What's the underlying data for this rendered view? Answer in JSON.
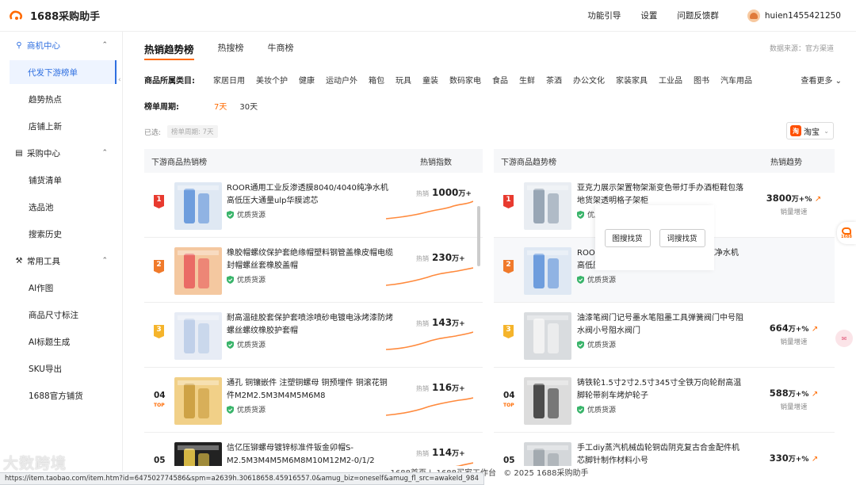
{
  "header": {
    "app_title": "1688采购助手",
    "nav": [
      "功能引导",
      "设置",
      "问题反馈群"
    ],
    "username": "huien1455421250"
  },
  "sidebar": {
    "groups": [
      {
        "label": "商机中心",
        "icon": "bulb-icon",
        "items": [
          "代发下游榜单",
          "趋势热点",
          "店铺上新"
        ]
      },
      {
        "label": "采购中心",
        "icon": "document-icon",
        "items": [
          "铺货清单",
          "选品池",
          "搜索历史"
        ]
      },
      {
        "label": "常用工具",
        "icon": "wrench-icon",
        "items": [
          "AI作图",
          "商品尺寸标注",
          "AI标题生成",
          "SKU导出",
          "1688官方铺货"
        ]
      }
    ],
    "active_item": "代发下游榜单"
  },
  "main": {
    "tabs": [
      "热销趋势榜",
      "热搜榜",
      "牛商榜"
    ],
    "active_tab": "热销趋势榜",
    "source_text": "数据来源：官方渠道",
    "category_label": "商品所属类目:",
    "categories": [
      "家居日用",
      "美妆个护",
      "健康",
      "运动户外",
      "箱包",
      "玩具",
      "童装",
      "数码家电",
      "食品",
      "生鲜",
      "茶酒",
      "办公文化",
      "家装家具",
      "工业品",
      "图书",
      "汽车用品"
    ],
    "category_more": "查看更多",
    "period_label": "榜单周期:",
    "periods": [
      "7天",
      "30天"
    ],
    "active_period": "7天",
    "selected_label": "已选:",
    "selected_chip": "榜单周期: 7天",
    "platform": "淘宝"
  },
  "left_panel": {
    "header": "下游商品热销榜",
    "col2": "热销指数",
    "metric_label": "热销",
    "rows": [
      {
        "rank": "1",
        "title": "ROOR通用工业反渗透膜8040/4040纯净水机高低压大通量ulp华膜滤芯",
        "badge": "优质货源",
        "value": "1000",
        "unit": "万+"
      },
      {
        "rank": "2",
        "title": "橡胶帽螺纹保护套绝缘帽塑料钢管盖橡皮帽电缆封帽螺丝套橡胶盖帽",
        "badge": "优质货源",
        "value": "230",
        "unit": "万+"
      },
      {
        "rank": "3",
        "title": "耐高温硅胶套保护套喷涂喷砂电镀电泳烤漆防烤螺丝螺纹橡胶护套帽",
        "badge": "优质货源",
        "value": "143",
        "unit": "万+"
      },
      {
        "rank": "04",
        "top": "TOP",
        "title": "通孔 铜镶嵌件 注塑铜螺母 铜预埋件 铜滚花铜件M2M2.5M3M4M5M6M8",
        "badge": "优质货源",
        "value": "116",
        "unit": "万+"
      },
      {
        "rank": "05",
        "top": "TOP",
        "title": "信亿压铆螺母镀锌标准件钣金卯帽S-M2.5M3M4M5M6M8M10M12M2-0/1/2",
        "badge": "优质货源",
        "value": "114",
        "unit": "万+"
      }
    ]
  },
  "right_panel": {
    "header": "下游商品趋势榜",
    "col2": "热销趋势",
    "sub_label": "销量增速",
    "rows": [
      {
        "rank": "1",
        "title": "亚克力展示架置物架渐变色带灯手办酒柜鞋包落地货架透明格子架柜",
        "badge": "优质货源",
        "value": "3800",
        "unit": "万+%"
      },
      {
        "rank": "2",
        "title": "ROOR通用工业反渗透膜8040/4040纯净水机高低压大通量ulp华膜滤芯",
        "badge": "优质货源",
        "value": "",
        "unit": ""
      },
      {
        "rank": "3",
        "title": "油漆笔阀门记号墨水笔阻墨工具弹簧阀门中号阻水阀小号阻水阀门",
        "badge": "优质货源",
        "value": "664",
        "unit": "万+%"
      },
      {
        "rank": "04",
        "top": "TOP",
        "title": "铸铁轮1.5寸2寸2.5寸345寸全铁万向轮耐高温脚轮带刹车烤炉轮子",
        "badge": "优质货源",
        "value": "588",
        "unit": "万+%"
      },
      {
        "rank": "05",
        "top": "TOP",
        "title": "手工diy蒸汽机械齿轮铜齿阴克复古合金配件机芯脚针制作材料小号",
        "badge": "优质货源",
        "value": "330",
        "unit": "万+%"
      }
    ],
    "hover_actions": [
      "图搜找货",
      "词搜找货"
    ]
  },
  "footer": {
    "links": [
      "1688首页",
      "1688买家工作台"
    ],
    "copyright": "© 2025 1688采购助手"
  },
  "status_url": "https://item.taobao.com/item.htm?id=647502774586&spm=a2639h.30618658.45916557.0&amug_biz=oneself&amug_fl_src=awakeId_984",
  "watermark": "大数跨境",
  "colors": {
    "accent": "#ff6a00",
    "link_blue": "#2f6fe0",
    "rank1": "#e83a2f",
    "rank2": "#f07a2b",
    "rank3": "#f5b42b"
  }
}
